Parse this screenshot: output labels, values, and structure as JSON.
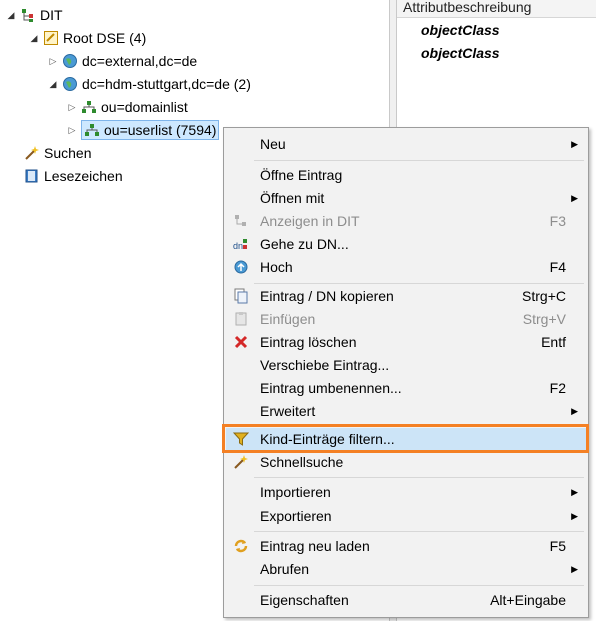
{
  "tree": {
    "root_label": "DIT",
    "root_dse_label": "Root DSE (4)",
    "node_external": "dc=external,dc=de",
    "node_hdm": "dc=hdm-stuttgart,dc=de (2)",
    "node_domainlist": "ou=domainlist",
    "node_userlist": "ou=userlist (7594)",
    "search_label": "Suchen",
    "bookmarks_label": "Lesezeichen"
  },
  "attributes": {
    "header": "Attributbeschreibung",
    "rows": [
      "objectClass",
      "objectClass"
    ]
  },
  "menu": {
    "neu": "Neu",
    "oeffne_eintrag": "Öffne Eintrag",
    "oeffnen_mit": "Öffnen mit",
    "anzeigen_in_dit": "Anzeigen in DIT",
    "anzeigen_in_dit_accel": "F3",
    "gehe_zu_dn": "Gehe zu DN...",
    "hoch": "Hoch",
    "hoch_accel": "F4",
    "kopieren": "Eintrag / DN kopieren",
    "kopieren_accel": "Strg+C",
    "einfuegen": "Einfügen",
    "einfuegen_accel": "Strg+V",
    "loeschen": "Eintrag löschen",
    "loeschen_accel": "Entf",
    "verschieben": "Verschiebe Eintrag...",
    "umbenennen": "Eintrag umbenennen...",
    "umbenennen_accel": "F2",
    "erweitert": "Erweitert",
    "filtern": "Kind-Einträge filtern...",
    "schnellsuche": "Schnellsuche",
    "importieren": "Importieren",
    "exportieren": "Exportieren",
    "neu_laden": "Eintrag neu laden",
    "neu_laden_accel": "F5",
    "abrufen": "Abrufen",
    "eigenschaften": "Eigenschaften",
    "eigenschaften_accel": "Alt+Eingabe"
  },
  "colors": {
    "highlight_frame": "#f48024",
    "menu_background": "#f2f2f2",
    "selection": "#cde8ff"
  }
}
